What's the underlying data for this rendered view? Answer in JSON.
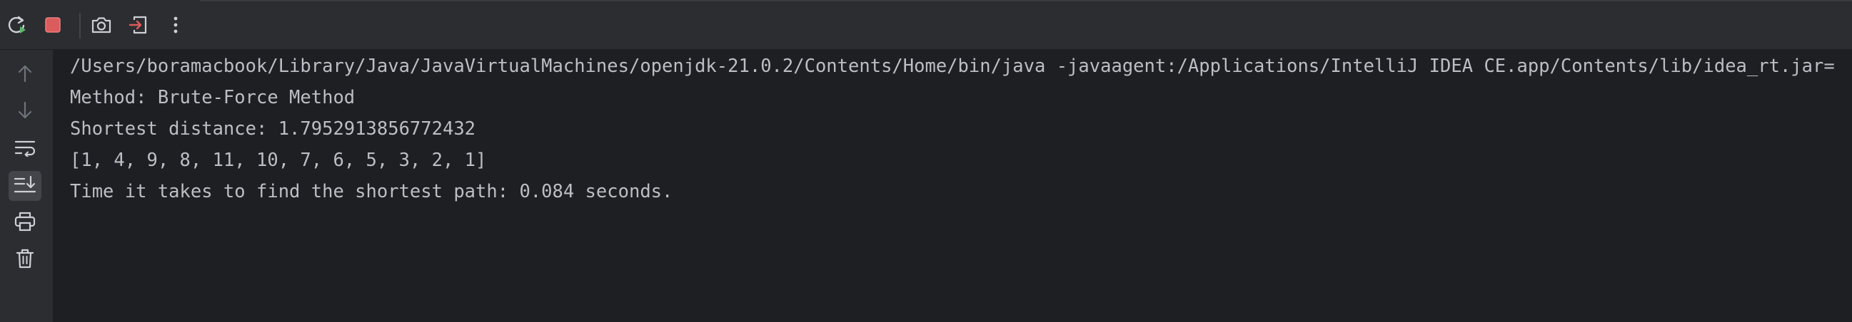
{
  "toolbar": {
    "buttons": [
      {
        "name": "rerun-icon",
        "tooltip": ""
      },
      {
        "name": "stop-icon",
        "tooltip": ""
      },
      {
        "name": "camera-icon",
        "tooltip": ""
      },
      {
        "name": "exit-icon",
        "tooltip": ""
      },
      {
        "name": "more-options-icon",
        "tooltip": ""
      }
    ]
  },
  "gutter": {
    "buttons": [
      {
        "name": "arrow-up-icon"
      },
      {
        "name": "arrow-down-icon"
      },
      {
        "name": "soft-wrap-icon"
      },
      {
        "name": "scroll-to-end-icon",
        "active": true
      },
      {
        "name": "print-icon"
      },
      {
        "name": "trash-icon"
      }
    ]
  },
  "console": {
    "lines": [
      "/Users/boramacbook/Library/Java/JavaVirtualMachines/openjdk-21.0.2/Contents/Home/bin/java -javaagent:/Applications/IntelliJ IDEA CE.app/Contents/lib/idea_rt.jar=",
      "Method: Brute-Force Method",
      "Shortest distance: 1.7952913856772432",
      "[1, 4, 9, 8, 11, 10, 7, 6, 5, 3, 2, 1]",
      "Time it takes to find the shortest path: 0.084 seconds."
    ]
  },
  "colors": {
    "background": "#1e1f22",
    "panel": "#2b2d30",
    "text": "#bcbec4",
    "rerun_green": "#5fb865",
    "stop_red": "#db5c5c",
    "icon_gray": "#ced0d6",
    "icon_disabled": "#6f737a"
  }
}
